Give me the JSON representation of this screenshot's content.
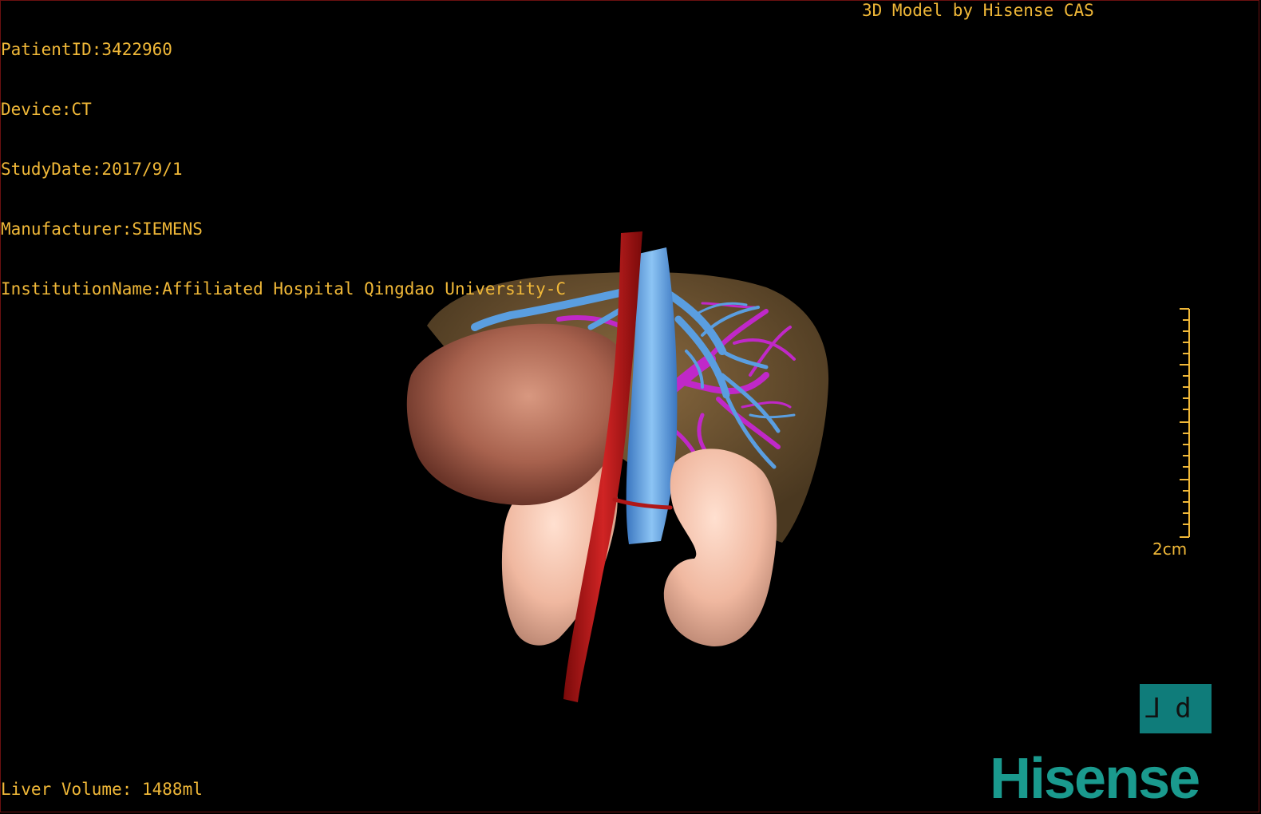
{
  "header": {
    "patient_id": "PatientID:3422960",
    "device": "Device:CT",
    "study_date": "StudyDate:2017/9/1",
    "manufacturer": "Manufacturer:SIEMENS",
    "institution": "InstitutionName:Affiliated Hospital Qingdao University-C"
  },
  "brand_caption": "3D Model by Hisense CAS",
  "liver_volume": "Liver Volume: 1488ml",
  "scale_bar": {
    "label": "2cm"
  },
  "orientation_marker": {
    "text": "⅃d"
  },
  "logo_text": "Hisense",
  "colors": {
    "overlay_text": "#f0b838",
    "liver": "#6e5432",
    "tumor": "#a8624e",
    "kidney": "#f0b8a0",
    "artery": "#b01818",
    "vein": "#5a9ee0",
    "portal_vein": "#c028c8",
    "logo": "#1a9a8e"
  }
}
